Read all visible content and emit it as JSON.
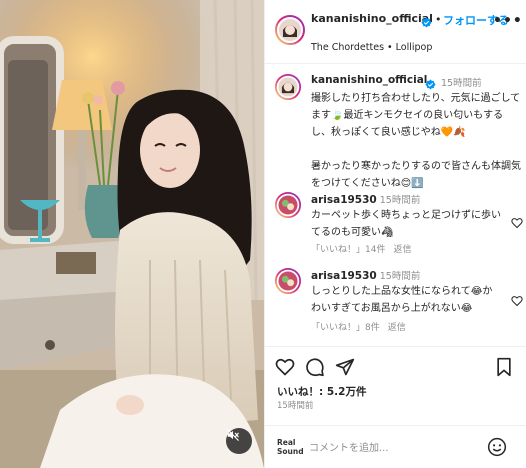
{
  "post": {
    "username": "kananishino_official",
    "follow_label": "フォローする",
    "separator": "•",
    "music": "The Chordettes • Lollipop",
    "more_label": "•••"
  },
  "caption": {
    "username": "kananishino_official",
    "time": "15時間前",
    "text": "撮影したり打ち合わせしたり、元気に過ごしてます🍃最近キンモクセイの良い匂いもするし、秋っぽくて良い感じやね🧡🍂\n\n暑かったり寒かったりするので皆さんも体調気をつけてくださいね😊⬇️"
  },
  "comments": [
    {
      "username": "arisa19530",
      "time": "15時間前",
      "text": "カーペット歩く時ちょっと足つけずに歩いてるのも可愛い🦓",
      "like_label": "「いいね！」14件",
      "reply_label": "返信"
    },
    {
      "username": "arisa19530",
      "time": "15時間前",
      "text": "しっとりした上品な女性になられて😂かわいすぎてお風呂から上がれない😂",
      "like_label": "「いいね！」8件",
      "reply_label": "返信"
    }
  ],
  "actions": {
    "likes": "いいね！: 5.2万件",
    "post_time": "15時間前"
  },
  "comment_box": {
    "placeholder": "コメントを追加...",
    "logo_line1": "Real",
    "logo_line2": "Sound"
  },
  "colors": {
    "accent": "#0095f6",
    "verified": "#0095f6",
    "muted": "#8e8e8e"
  }
}
